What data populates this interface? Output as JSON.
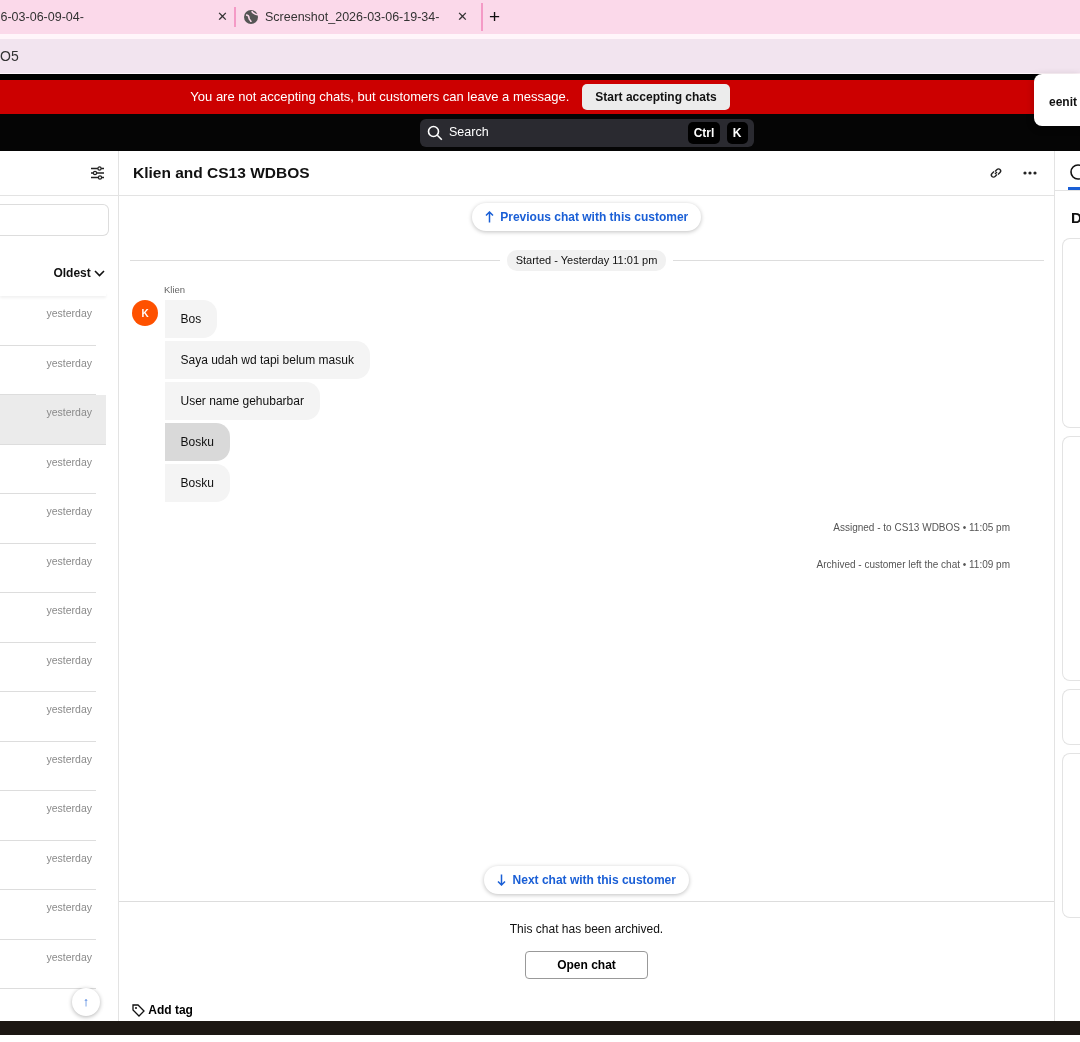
{
  "browser": {
    "tabs": [
      {
        "title": "6-03-06-09-04-",
        "selected": false
      },
      {
        "title": "Screenshot_2026-03-06-19-34-",
        "selected": true
      }
    ],
    "new_tab": "+",
    "close": "✕",
    "address": "O5"
  },
  "banner": {
    "message": "You are not accepting chats, but customers can leave a message.",
    "button": "Start accepting chats"
  },
  "popup": {
    "text": "eenit"
  },
  "search": {
    "placeholder": "Search",
    "keys": [
      "Ctrl",
      "K"
    ]
  },
  "chat_list": {
    "sort": "Oldest",
    "scroll_top": "↑",
    "items": [
      {
        "time": "yesterday",
        "selected": false
      },
      {
        "time": "yesterday",
        "selected": false
      },
      {
        "time": "yesterday",
        "selected": true
      },
      {
        "time": "yesterday",
        "selected": false
      },
      {
        "time": "yesterday",
        "selected": false
      },
      {
        "time": "yesterday",
        "selected": false
      },
      {
        "time": "yesterday",
        "selected": false
      },
      {
        "time": "yesterday",
        "selected": false
      },
      {
        "time": "yesterday",
        "selected": false
      },
      {
        "time": "yesterday",
        "selected": false
      },
      {
        "time": "yesterday",
        "selected": false
      },
      {
        "time": "yesterday",
        "selected": false
      },
      {
        "time": "yesterday",
        "selected": false
      },
      {
        "time": "yesterday",
        "selected": false
      }
    ]
  },
  "chat": {
    "title": "Klien and CS13 WDBOS",
    "previous": "Previous chat with this customer",
    "started": "Started - Yesterday 11:01 pm",
    "sender": "Klien",
    "avatar": "K",
    "messages": [
      {
        "text": "Bos",
        "selected": false
      },
      {
        "text": "Saya udah wd tapi belum masuk",
        "selected": false
      },
      {
        "text": "User name gehubarbar",
        "selected": false
      },
      {
        "text": "Bosku",
        "selected": true
      },
      {
        "text": "Bosku",
        "selected": false
      }
    ],
    "events": [
      "Assigned - to CS13 WDBOS • 11:05 pm",
      "Archived - customer left the chat • 11:09 pm"
    ],
    "next": "Next chat with this customer",
    "archived_note": "This chat has been archived.",
    "open_button": "Open chat",
    "add_tag": "Add tag"
  },
  "details": {
    "title": "D"
  }
}
